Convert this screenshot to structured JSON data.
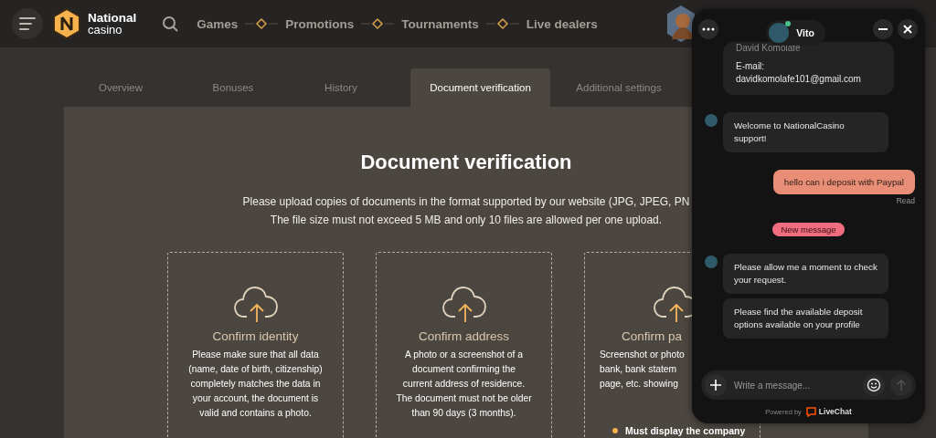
{
  "header": {
    "logo": {
      "line1": "National",
      "line2": "casino"
    },
    "nav": [
      {
        "label": "Games"
      },
      {
        "label": "Promotions"
      },
      {
        "label": "Tournaments"
      },
      {
        "label": "Live dealers"
      }
    ]
  },
  "tabs": [
    {
      "label": "Overview",
      "selected": false
    },
    {
      "label": "Bonuses",
      "selected": false
    },
    {
      "label": "History",
      "selected": false
    },
    {
      "label": "Document verification",
      "selected": true
    },
    {
      "label": "Additional settings",
      "selected": false
    }
  ],
  "verification": {
    "title": "Document verification",
    "intro": [
      "Please upload copies of documents in the format supported by our website (JPG, JPEG, PN",
      "The file size must not exceed 5 MB and only 10 files are allowed per one upload."
    ],
    "cards": [
      {
        "title": "Confirm identity",
        "text": [
          "Please make sure that all data",
          "(name, date of birth, citizenship)",
          "completely matches the data in",
          "your account, the document is",
          "valid and contains a photo."
        ]
      },
      {
        "title": "Confirm address",
        "text": [
          "A photo or a screenshot of a",
          "document confirming the",
          "current address of residence.",
          "The document must not be older",
          "than 90 days (3 months)."
        ]
      },
      {
        "title": "Confirm pa",
        "text": [
          "Screenshot or photo",
          "bank, bank statem",
          "page, etc. showing"
        ],
        "bullets": [
          "Must display the company"
        ]
      }
    ]
  },
  "chat": {
    "agent": {
      "name": "Vito",
      "online": true
    },
    "messages": [
      {
        "kind": "info",
        "lines": [
          "David Komolafe",
          "E-mail:",
          "davidkomolafe101@gmail.com"
        ]
      },
      {
        "kind": "agent",
        "avatar": true,
        "text": "Welcome to NationalCasino support!"
      },
      {
        "kind": "visitor",
        "text": "hello can i deposit with Paypal",
        "status": "Read"
      },
      {
        "kind": "divider",
        "text": "New message"
      },
      {
        "kind": "agent",
        "avatar": true,
        "text": "Please allow me a moment to check your request."
      },
      {
        "kind": "agent",
        "avatar": false,
        "text": "Please find the available deposit options available on your profile"
      }
    ],
    "composer": {
      "placeholder": "Write a message..."
    },
    "footer": {
      "prefix": "Powered by",
      "brand": "LiveChat"
    }
  }
}
